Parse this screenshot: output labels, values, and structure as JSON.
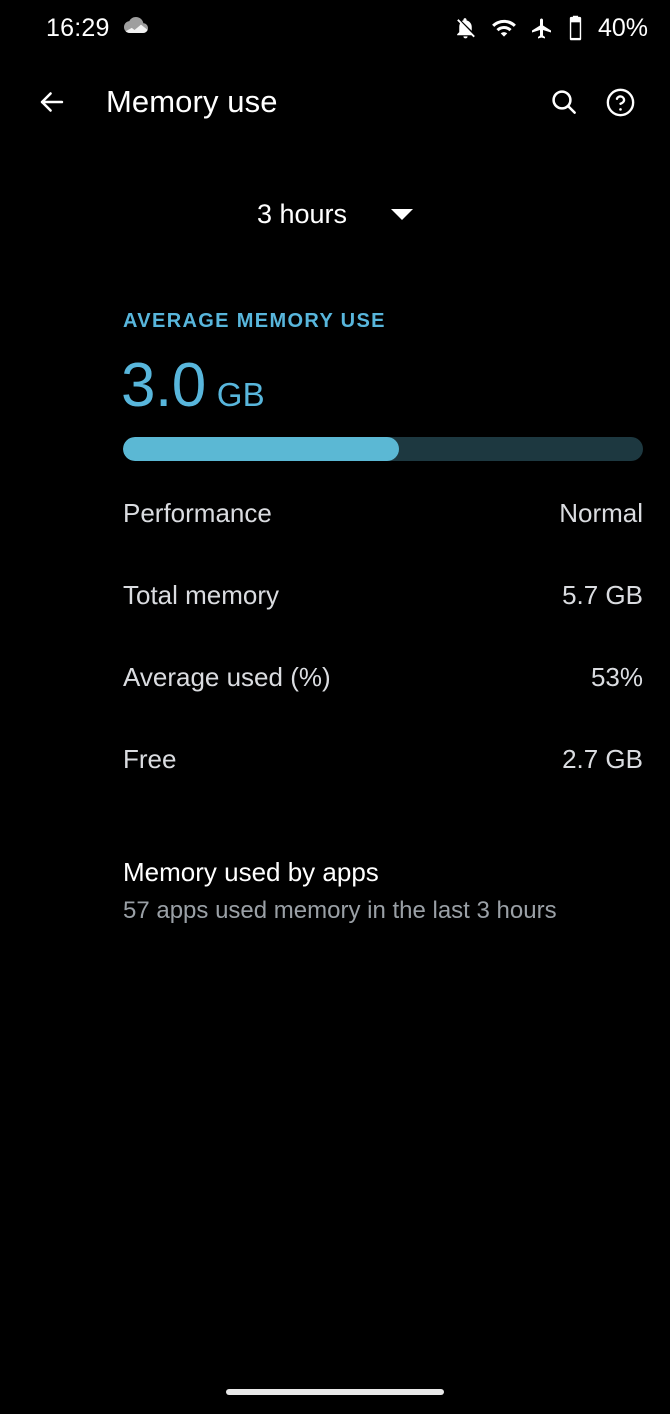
{
  "status_bar": {
    "clock": "16:29",
    "notification_icon": "cloud-icon",
    "icons": [
      "notifications-off-icon",
      "wifi-icon",
      "airplane-mode-icon",
      "battery-icon"
    ],
    "battery_percent": "40%"
  },
  "app_bar": {
    "back_icon": "back-arrow-icon",
    "title": "Memory use",
    "search_icon": "search-icon",
    "help_icon": "help-circle-icon"
  },
  "spinner": {
    "selected": "3 hours",
    "caret_icon": "chevron-down-icon"
  },
  "summary": {
    "section_label": "AVERAGE MEMORY USE",
    "value_number": "3.0",
    "value_unit": "GB",
    "progress_percent": 53,
    "accent_color": "#5BB8D4",
    "track_color": "#1D3840",
    "label_color": "#58B6DC"
  },
  "details": {
    "rows": [
      {
        "label": "Performance",
        "value": "Normal"
      },
      {
        "label": "Total memory",
        "value": "5.7 GB"
      },
      {
        "label": "Average used (%)",
        "value": "53%"
      },
      {
        "label": "Free",
        "value": "2.7 GB"
      }
    ]
  },
  "apps_section": {
    "title": "Memory used by apps",
    "subtitle": "57 apps used memory in the last 3 hours"
  }
}
